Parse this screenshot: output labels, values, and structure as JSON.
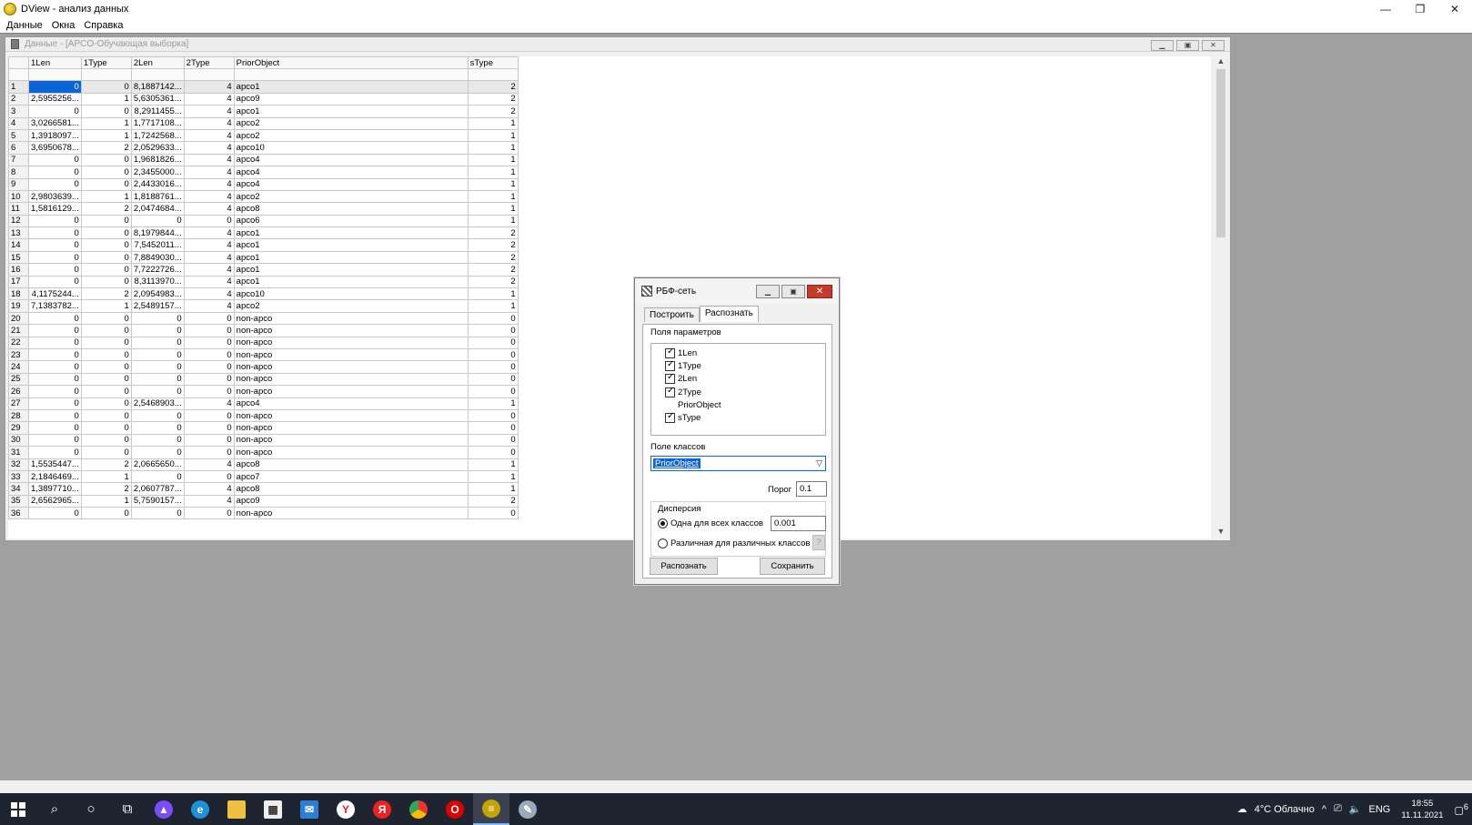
{
  "app": {
    "title": "DView - анализ данных",
    "min": "—",
    "max": "❐",
    "close": "✕"
  },
  "menu": [
    "Данные",
    "Окна",
    "Справка"
  ],
  "data_window": {
    "title": "Данные - [APCO-Обучающая выборка]",
    "columns": [
      "1Len",
      "1Type",
      "2Len",
      "2Type",
      "PriorObject",
      "sType"
    ],
    "rows": [
      [
        "1",
        "0",
        "0",
        "8,1887142...",
        "4",
        "apco1",
        "2"
      ],
      [
        "2",
        "2,5955256...",
        "1",
        "5,6305361...",
        "4",
        "apco9",
        "2"
      ],
      [
        "3",
        "0",
        "0",
        "8,2911455...",
        "4",
        "apco1",
        "2"
      ],
      [
        "4",
        "3,0266581...",
        "1",
        "1,7717108...",
        "4",
        "apco2",
        "1"
      ],
      [
        "5",
        "1,3918097...",
        "1",
        "1,7242568...",
        "4",
        "apco2",
        "1"
      ],
      [
        "6",
        "3,6950678...",
        "2",
        "2,0529633...",
        "4",
        "apco10",
        "1"
      ],
      [
        "7",
        "0",
        "0",
        "1,9681826...",
        "4",
        "apco4",
        "1"
      ],
      [
        "8",
        "0",
        "0",
        "2,3455000...",
        "4",
        "apco4",
        "1"
      ],
      [
        "9",
        "0",
        "0",
        "2,4433016...",
        "4",
        "apco4",
        "1"
      ],
      [
        "10",
        "2,9803639...",
        "1",
        "1,8188761...",
        "4",
        "apco2",
        "1"
      ],
      [
        "11",
        "1,5816129...",
        "2",
        "2,0474684...",
        "4",
        "apco8",
        "1"
      ],
      [
        "12",
        "0",
        "0",
        "0",
        "0",
        "apco6",
        "1"
      ],
      [
        "13",
        "0",
        "0",
        "8,1979844...",
        "4",
        "apco1",
        "2"
      ],
      [
        "14",
        "0",
        "0",
        "7,5452011...",
        "4",
        "apco1",
        "2"
      ],
      [
        "15",
        "0",
        "0",
        "7,8849030...",
        "4",
        "apco1",
        "2"
      ],
      [
        "16",
        "0",
        "0",
        "7,7222726...",
        "4",
        "apco1",
        "2"
      ],
      [
        "17",
        "0",
        "0",
        "8,3113970...",
        "4",
        "apco1",
        "2"
      ],
      [
        "18",
        "4,1175244...",
        "2",
        "2,0954983...",
        "4",
        "apco10",
        "1"
      ],
      [
        "19",
        "7,1383782...",
        "1",
        "2,5489157...",
        "4",
        "apco2",
        "1"
      ],
      [
        "20",
        "0",
        "0",
        "0",
        "0",
        "non-apco",
        "0"
      ],
      [
        "21",
        "0",
        "0",
        "0",
        "0",
        "non-apco",
        "0"
      ],
      [
        "22",
        "0",
        "0",
        "0",
        "0",
        "non-apco",
        "0"
      ],
      [
        "23",
        "0",
        "0",
        "0",
        "0",
        "non-apco",
        "0"
      ],
      [
        "24",
        "0",
        "0",
        "0",
        "0",
        "non-apco",
        "0"
      ],
      [
        "25",
        "0",
        "0",
        "0",
        "0",
        "non-apco",
        "0"
      ],
      [
        "26",
        "0",
        "0",
        "0",
        "0",
        "non-apco",
        "0"
      ],
      [
        "27",
        "0",
        "0",
        "2,5468903...",
        "4",
        "apco4",
        "1"
      ],
      [
        "28",
        "0",
        "0",
        "0",
        "0",
        "non-apco",
        "0"
      ],
      [
        "29",
        "0",
        "0",
        "0",
        "0",
        "non-apco",
        "0"
      ],
      [
        "30",
        "0",
        "0",
        "0",
        "0",
        "non-apco",
        "0"
      ],
      [
        "31",
        "0",
        "0",
        "0",
        "0",
        "non-apco",
        "0"
      ],
      [
        "32",
        "1,5535447...",
        "2",
        "2,0665650...",
        "4",
        "apco8",
        "1"
      ],
      [
        "33",
        "2,1846469...",
        "1",
        "0",
        "0",
        "apco7",
        "1"
      ],
      [
        "34",
        "1,3897710...",
        "2",
        "2,0607787...",
        "4",
        "apco8",
        "1"
      ],
      [
        "35",
        "2,6562965...",
        "1",
        "5,7590157...",
        "4",
        "apco9",
        "2"
      ],
      [
        "36",
        "0",
        "0",
        "0",
        "0",
        "non-apco",
        "0"
      ]
    ]
  },
  "dialog": {
    "title": "РБФ-сеть",
    "tabs": [
      "Построить",
      "Распознать"
    ],
    "params_label": "Поля параметров",
    "params": [
      {
        "label": "1Len",
        "checked": true
      },
      {
        "label": "1Type",
        "checked": true
      },
      {
        "label": "2Len",
        "checked": true
      },
      {
        "label": "2Type",
        "checked": true
      },
      {
        "label": "PriorObject",
        "checked": false
      },
      {
        "label": "sType",
        "checked": true
      }
    ],
    "class_field_label": "Поле классов",
    "class_field_value": "PriorObject",
    "threshold_label": "Порог",
    "threshold_value": "0.1",
    "dispersion_label": "Дисперсия",
    "radio_same_label": "Одна для всех классов",
    "radio_same_value": "0.001",
    "radio_diff_label": "Различная для различных классов",
    "help_button": "?",
    "recognize_button": "Распознать",
    "save_button": "Сохранить"
  },
  "taskbar": {
    "weather": "4°C Облачно",
    "lang": "ENG",
    "time": "18:55",
    "date": "11.11.2021",
    "notifications": "6"
  }
}
